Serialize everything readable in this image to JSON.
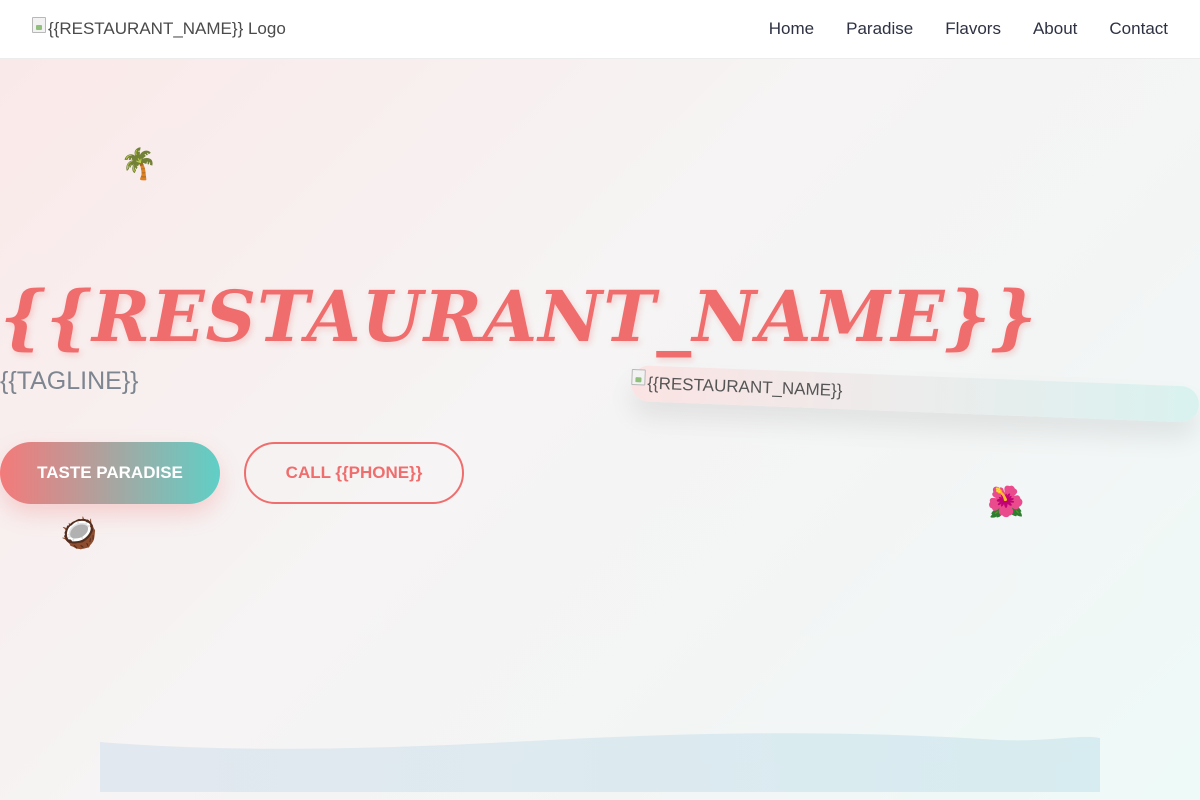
{
  "header": {
    "logo_alt": "{{RESTAURANT_NAME}} Logo",
    "nav": [
      {
        "label": "Home"
      },
      {
        "label": "Paradise"
      },
      {
        "label": "Flavors"
      },
      {
        "label": "About"
      },
      {
        "label": "Contact"
      }
    ]
  },
  "hero": {
    "title": "{{RESTAURANT_NAME}}",
    "tagline": "{{TAGLINE}}",
    "primary_button": "TASTE PARADISE",
    "secondary_button": "CALL {{PHONE}}",
    "image_alt": "{{RESTAURANT_NAME}}",
    "decorations": {
      "palm": "🌴",
      "coconut": "🥥",
      "hibiscus": "🌺"
    }
  },
  "colors": {
    "accent": "#f06d6d",
    "teal": "#5fcfc6",
    "nav_text": "#2d3142"
  }
}
